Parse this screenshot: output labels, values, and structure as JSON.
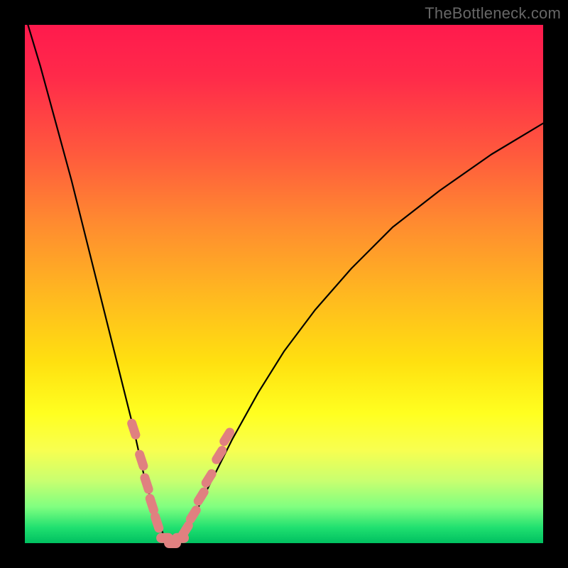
{
  "watermark": "TheBottleneck.com",
  "colors": {
    "curve_stroke": "#000000",
    "marker_fill": "#e08080",
    "marker_stroke": "#c86868"
  },
  "chart_data": {
    "type": "line",
    "title": "",
    "xlabel": "",
    "ylabel": "",
    "xlim": [
      0,
      100
    ],
    "ylim": [
      0,
      100
    ],
    "x": [
      0,
      3,
      6,
      9,
      12,
      15,
      18,
      21,
      23,
      25,
      27,
      28.5,
      30,
      33,
      36,
      40,
      45,
      50,
      56,
      63,
      71,
      80,
      90,
      100
    ],
    "values": [
      102,
      92,
      81,
      70,
      58,
      46,
      34,
      22,
      13,
      6,
      1,
      0,
      1.5,
      6,
      12,
      20,
      29,
      37,
      45,
      53,
      61,
      68,
      75,
      81
    ],
    "markers": {
      "left_branch": [
        {
          "x": 21.0,
          "y": 22.0
        },
        {
          "x": 22.5,
          "y": 16.0
        },
        {
          "x": 23.5,
          "y": 11.5
        },
        {
          "x": 24.5,
          "y": 7.5
        },
        {
          "x": 25.5,
          "y": 4.0
        }
      ],
      "right_branch": [
        {
          "x": 31.0,
          "y": 2.5
        },
        {
          "x": 32.5,
          "y": 5.5
        },
        {
          "x": 34.0,
          "y": 9.0
        },
        {
          "x": 35.5,
          "y": 12.5
        },
        {
          "x": 37.5,
          "y": 17.0
        },
        {
          "x": 39.0,
          "y": 20.5
        }
      ],
      "bottom": [
        {
          "x": 27.0,
          "y": 1.0
        },
        {
          "x": 28.5,
          "y": 0.0
        },
        {
          "x": 30.0,
          "y": 1.0
        }
      ]
    }
  }
}
